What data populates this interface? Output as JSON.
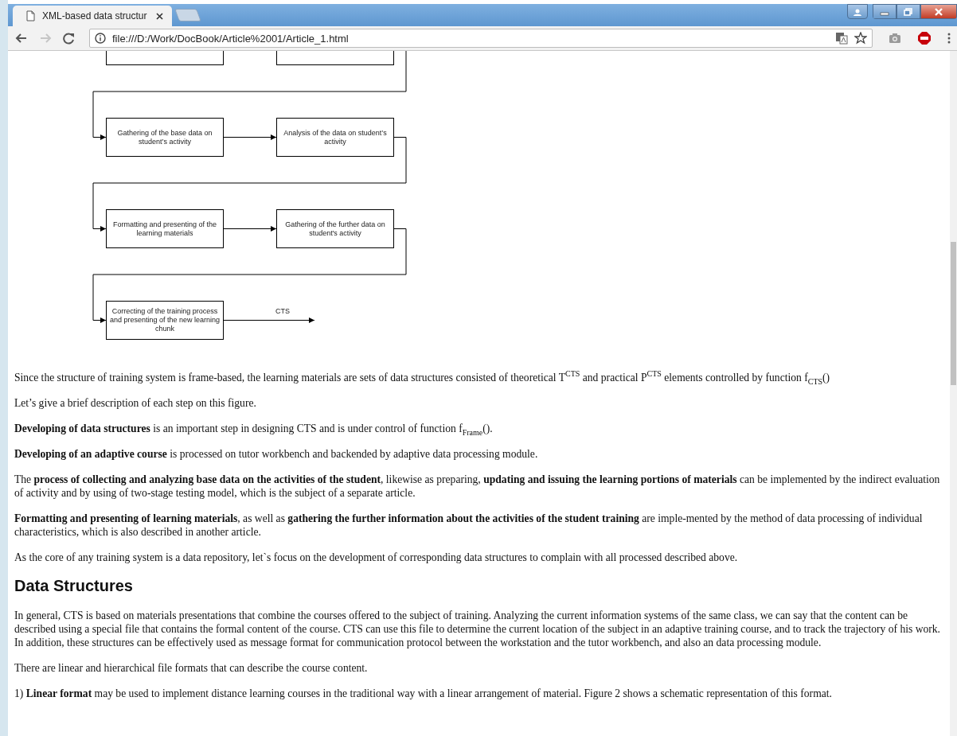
{
  "browser": {
    "tabs": [
      {
        "title": "XML-based data structur",
        "selected": true
      }
    ],
    "forward_disabled": true,
    "address": "file:///D:/Work/DocBook/Article%2001/Article_1.html"
  },
  "figure": {
    "rows": [
      {
        "nodes": [
          {
            "kind": "step"
          },
          {
            "kind": "step"
          }
        ]
      },
      {
        "nodes": [
          {
            "kind": "step",
            "text": "Gathering of the base data on student’s activity"
          },
          {
            "kind": "step",
            "text": "Analysis of the data on student’s activity"
          }
        ]
      },
      {
        "nodes": [
          {
            "kind": "step",
            "text": "Formatting and presenting of the learning materials"
          },
          {
            "kind": "step",
            "text": "Gathering of the further data on student's activity"
          }
        ]
      },
      {
        "nodes": [
          {
            "kind": "step",
            "text": "Correcting of the training process and presenting of the new learning chunk"
          },
          {
            "kind": "output",
            "text": "CTS"
          }
        ]
      }
    ]
  },
  "article": [
    {
      "kind": "paragraph",
      "text": "Since the structure of training system is frame-based, the learning materials are sets of data structures consisted of theoretical T$^{CTS}$ and practical P$^{CTS}$ elements controlled by function f$_{CTS}$()"
    },
    {
      "kind": "paragraph",
      "text": "Let’s give a brief description of each step on this figure."
    },
    {
      "kind": "paragraph",
      "text": "**Developing of data structures** is an important step in designing CTS and is under control of function f$_{Frame}$()."
    },
    {
      "kind": "paragraph",
      "text": "**Developing of an adaptive course** is processed on tutor workbench and backended by adaptive data processing module."
    },
    {
      "kind": "paragraph",
      "text": "The **process of collecting and analyzing base data on the activities of the student**, likewise as preparing, **updating and issuing the learning portions of materials** can be implemented by the indirect evaluation of activity and by using of two-stage testing model, which is the subject of a separate article."
    },
    {
      "kind": "paragraph",
      "text": "**Formatting and presenting of learning materials**, as well as **gathering the further information about the activities of the student training** are imple-mented by the method of data processing of individual characteristics, which is also described in another article."
    },
    {
      "kind": "paragraph",
      "text": "As the core of any training system is a data repository, let`s focus on the development of corresponding data structures to complain with all processed described above."
    },
    {
      "kind": "heading",
      "text": "Data Structures"
    },
    {
      "kind": "paragraph",
      "text": "In general, CTS is based on materials presentations that combine the courses offered to the subject of training. Analyzing the current information systems of the same class, we can say that the content can be described using a special file that contains the formal content of the course. CTS can use this file to determine the current location of the subject in an adaptive training course, and to track the trajectory of his work. In addition, these structures can be effectively used as message format for communication protocol between the workstation and the tutor workbench, and also an data processing module."
    },
    {
      "kind": "paragraph",
      "text": "There are linear and hierarchical file formats that can describe the course content."
    },
    {
      "kind": "paragraph",
      "text": "1) **Linear format** may be used to implement distance learning courses in the traditional way with a linear arrangement of material. Figure 2 shows a schematic representation of this format."
    }
  ]
}
